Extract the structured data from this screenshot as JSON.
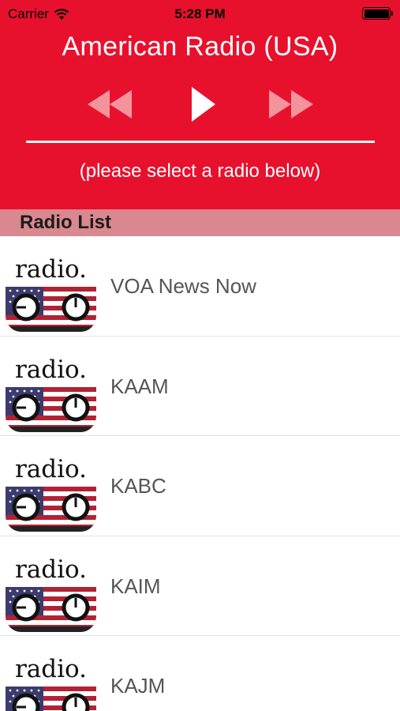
{
  "status_bar": {
    "carrier": "Carrier",
    "time": "5:28 PM",
    "battery_level": 1.0
  },
  "header": {
    "title": "American Radio (USA)",
    "hint": "(please select a radio below)",
    "background_color": "#e8112d",
    "controls": {
      "prev_icon": "rewind-icon",
      "play_icon": "play-icon",
      "next_icon": "fast-forward-icon"
    }
  },
  "section": {
    "title": "Radio List",
    "background_color": "#d8888e"
  },
  "radios": [
    {
      "name": "VOA News Now",
      "logo_text": "radio."
    },
    {
      "name": "KAAM",
      "logo_text": "radio."
    },
    {
      "name": "KABC",
      "logo_text": "radio."
    },
    {
      "name": "KAIM",
      "logo_text": "radio."
    },
    {
      "name": "KAJM",
      "logo_text": "radio."
    }
  ]
}
